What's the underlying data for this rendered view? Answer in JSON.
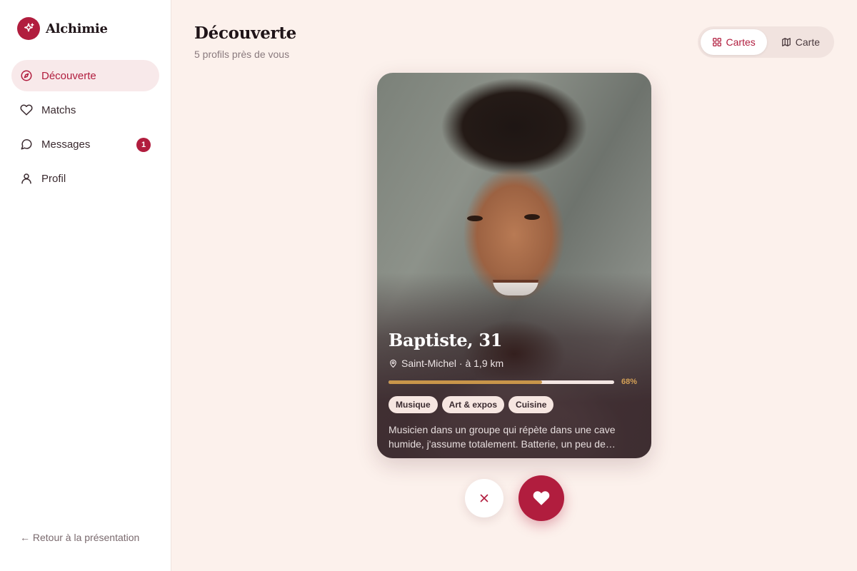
{
  "app": {
    "name": "Alchimie"
  },
  "sidebar": {
    "items": [
      {
        "label": "Découverte",
        "icon": "compass-icon",
        "active": true
      },
      {
        "label": "Matchs",
        "icon": "heart-icon"
      },
      {
        "label": "Messages",
        "icon": "chat-icon",
        "badge": "1"
      },
      {
        "label": "Profil",
        "icon": "user-icon"
      }
    ],
    "back_label": "← Retour à la présentation"
  },
  "header": {
    "title": "Découverte",
    "subtitle": "5 profils près de vous"
  },
  "view_toggle": {
    "cards_label": "Cartes",
    "map_label": "Carte",
    "selected": "Cartes"
  },
  "profile": {
    "name_age": "Baptiste, 31",
    "location": "Saint-Michel · à 1,9 km",
    "compatibility": 0.68,
    "compatibility_label": "68%",
    "tags": [
      "Musique",
      "Art & expos",
      "Cuisine"
    ],
    "bio": "Musicien dans un groupe qui répète dans une cave humide, j'assume totalement. Batterie, un peu de…"
  },
  "colors": {
    "accent": "#b11d3e",
    "background": "#fcf1ec",
    "compat_fill": "#c8954a"
  }
}
